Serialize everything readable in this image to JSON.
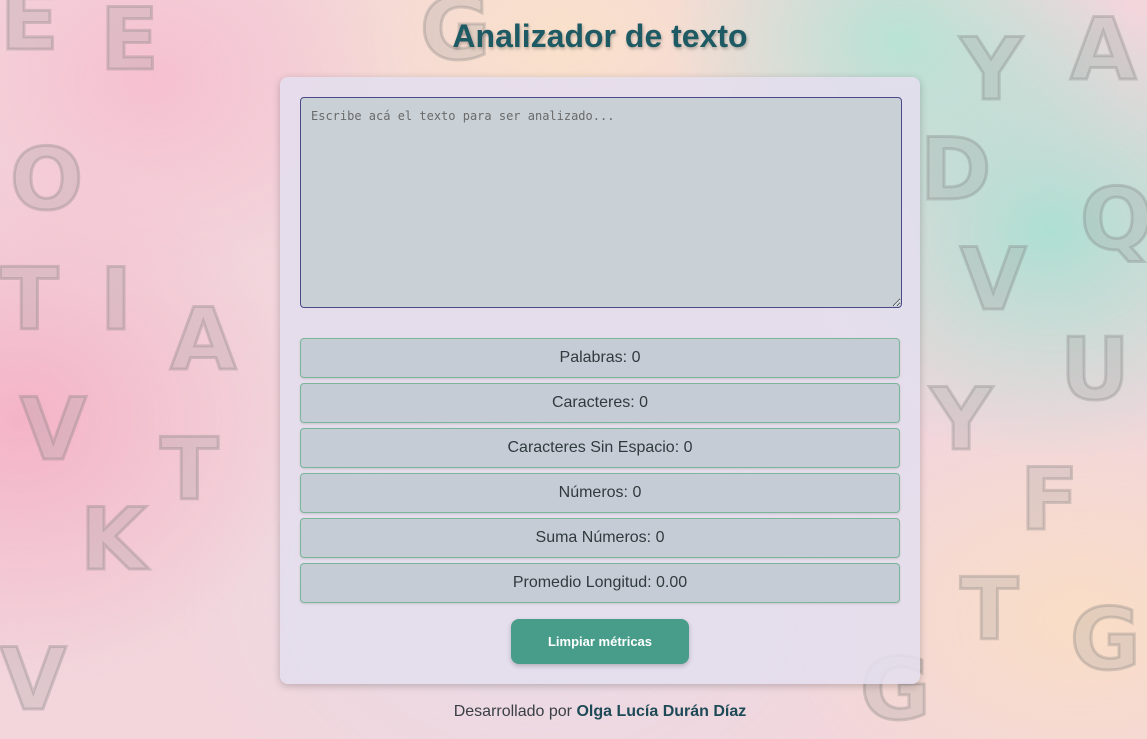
{
  "page": {
    "title": "Analizador de texto"
  },
  "editor": {
    "placeholder": "Escribe acá el texto para ser analizado...",
    "value": ""
  },
  "metrics": [
    {
      "label": "Palabras: 0"
    },
    {
      "label": "Caracteres: 0"
    },
    {
      "label": "Caracteres Sin Espacio: 0"
    },
    {
      "label": "Números: 0"
    },
    {
      "label": "Suma Números: 0"
    },
    {
      "label": "Promedio Longitud: 0.00"
    }
  ],
  "actions": {
    "clear_label": "Limpiar métricas"
  },
  "footer": {
    "prefix": "Desarrollado por ",
    "author": "Olga Lucía Durán Díaz"
  },
  "colors": {
    "title": "#1e5a63",
    "button": "#479d8a",
    "metric_border": "#7bb69a",
    "textarea_border": "#4a4a8a"
  }
}
